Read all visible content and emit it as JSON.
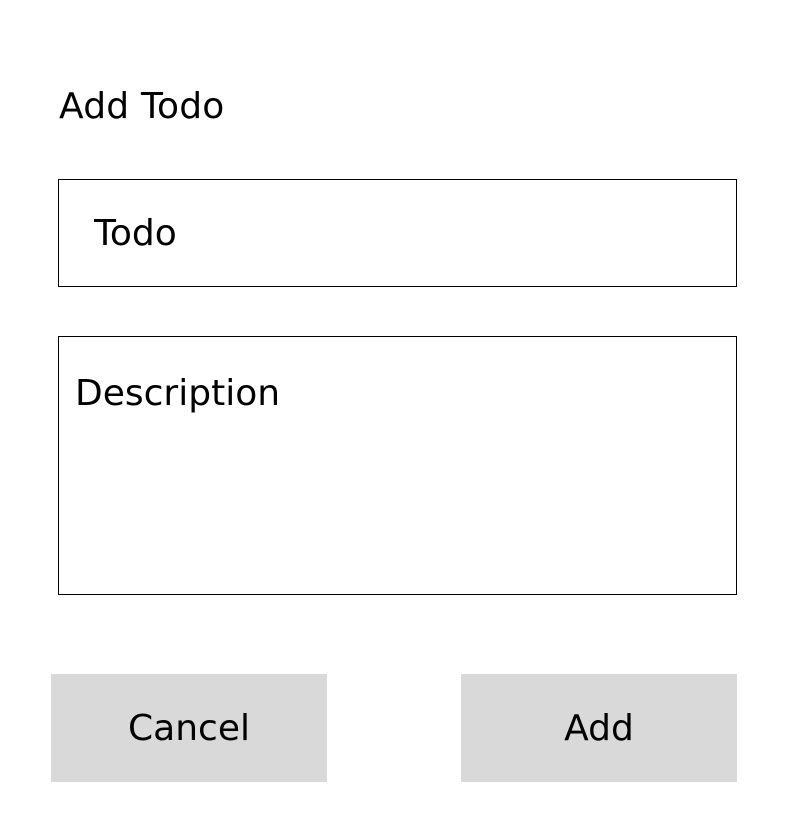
{
  "dialog": {
    "title": "Add Todo",
    "todo_field": {
      "value": "",
      "placeholder": "Todo"
    },
    "description_field": {
      "value": "",
      "placeholder": "Description"
    },
    "buttons": {
      "cancel_label": "Cancel",
      "add_label": "Add"
    }
  },
  "colors": {
    "background": "#ffffff",
    "text": "#000000",
    "field_border": "#000000",
    "button_background": "#d9d9d9"
  }
}
